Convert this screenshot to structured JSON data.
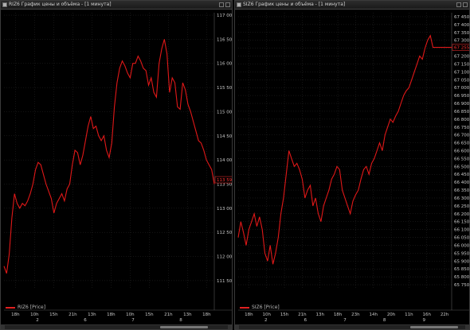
{
  "panels": [
    {
      "title": "RIZ6 График цены и объёма - [1 минута]",
      "legend": "RIZ6 [Price]",
      "last_price_label": "113 590",
      "colors": {
        "line": "#e01818",
        "grid": "#2a2a2a",
        "text": "#c8c8c8",
        "last": "#ff3030"
      },
      "chart_data": {
        "type": "line",
        "series": [
          {
            "name": "RIZ6 [Price]",
            "x": [
              0,
              3,
              6,
              9,
              12,
              15,
              18,
              21,
              24,
              27,
              30,
              33,
              36,
              39,
              42,
              45,
              48,
              51,
              54,
              57,
              60,
              63,
              66,
              69,
              72,
              75,
              78,
              81,
              84,
              87,
              90,
              93,
              96,
              99,
              102,
              105,
              108,
              111,
              114,
              117,
              120,
              123,
              126,
              129,
              132,
              135,
              138,
              141,
              144,
              147,
              150,
              153,
              156,
              159,
              162,
              165,
              168,
              171,
              174,
              177,
              180,
              183,
              186,
              189,
              192,
              195,
              198,
              201,
              204,
              207,
              210,
              213,
              216,
              219,
              222,
              225,
              228,
              231,
              234,
              237,
              240
            ],
            "values": [
              111800,
              111650,
              112050,
              112800,
              113300,
              113100,
              113000,
              113100,
              113050,
              113150,
              113300,
              113500,
              113800,
              113950,
              113900,
              113700,
              113500,
              113350,
              113200,
              112900,
              113100,
              113200,
              113300,
              113150,
              113400,
              113500,
              113900,
              114200,
              114150,
              113900,
              114100,
              114400,
              114700,
              114900,
              114650,
              114700,
              114500,
              114400,
              114500,
              114200,
              114050,
              114350,
              115100,
              115600,
              115900,
              116050,
              115950,
              115800,
              115700,
              116000,
              116000,
              116150,
              116050,
              115900,
              115850,
              115550,
              115700,
              115400,
              115300,
              116000,
              116300,
              116500,
              116200,
              115400,
              115700,
              115600,
              115100,
              115050,
              115600,
              115450,
              115150,
              115000,
              114800,
              114600,
              114400,
              114350,
              114200,
              114000,
              113900,
              113800,
              113500
            ]
          }
        ],
        "x_tick_labels": [
          "18h",
          "10h",
          "15h",
          "21h",
          "13h",
          "18h",
          "10h",
          "15h",
          "21h",
          "13h",
          "18h"
        ],
        "x_day_labels": [
          "2",
          "6",
          "7",
          "8"
        ],
        "y_tick_labels": [
          "117 000",
          "116 500",
          "116 000",
          "115 500",
          "115 000",
          "114 500",
          "114 000",
          "113 500",
          "113 000",
          "112 500",
          "112 000",
          "111 500"
        ],
        "ylim": [
          111350,
          117050
        ],
        "grid": true,
        "legend_position": "bottom-left"
      }
    },
    {
      "title": "SIZ6 График цены и объёма - [1 минута]",
      "legend": "SIZ6 [Price]",
      "last_price_label": "67 255",
      "colors": {
        "line": "#e01818",
        "grid": "#2a2a2a",
        "text": "#c8c8c8",
        "last": "#ff3030"
      },
      "chart_data": {
        "type": "line",
        "series": [
          {
            "name": "SIZ6 [Price]",
            "x": [
              0,
              3,
              6,
              9,
              12,
              15,
              18,
              21,
              24,
              27,
              30,
              33,
              36,
              39,
              42,
              45,
              48,
              51,
              54,
              57,
              60,
              63,
              66,
              69,
              72,
              75,
              78,
              81,
              84,
              87,
              90,
              93,
              96,
              99,
              102,
              105,
              108,
              111,
              114,
              117,
              120,
              123,
              126,
              129,
              132,
              135,
              138,
              141,
              144,
              147,
              150,
              153,
              156,
              159,
              162,
              165,
              168,
              171,
              174,
              177,
              180,
              183,
              186,
              189,
              192,
              195,
              198,
              201,
              204,
              207,
              210,
              213,
              216,
              219,
              222,
              225,
              228,
              231,
              234,
              237,
              240
            ],
            "values": [
              66050,
              66150,
              66080,
              66000,
              66100,
              66150,
              66200,
              66120,
              66180,
              66100,
              65950,
              65900,
              66000,
              65880,
              65950,
              66050,
              66200,
              66300,
              66450,
              66600,
              66550,
              66500,
              66520,
              66480,
              66420,
              66300,
              66350,
              66380,
              66250,
              66300,
              66200,
              66150,
              66250,
              66300,
              66350,
              66420,
              66450,
              66500,
              66480,
              66350,
              66300,
              66250,
              66200,
              66280,
              66320,
              66350,
              66420,
              66480,
              66500,
              66450,
              66520,
              66550,
              66600,
              66650,
              66600,
              66700,
              66750,
              66800,
              66780,
              66820,
              66850,
              66900,
              66950,
              66980,
              67000,
              67050,
              67100,
              67150,
              67200,
              67180,
              67250,
              67300,
              67330,
              67255,
              67255,
              67255,
              67255,
              67255,
              67255,
              67255,
              67255
            ]
          }
        ],
        "x_tick_labels": [
          "18h",
          "10h",
          "15h",
          "21h",
          "13h",
          "18h",
          "23h",
          "14h",
          "20h",
          "11h",
          "16h",
          "22h"
        ],
        "x_day_labels": [
          "2",
          "6",
          "7",
          "8",
          "9"
        ],
        "y_tick_labels": [
          "67 450",
          "67 400",
          "67 350",
          "67 300",
          "67 250",
          "67 200",
          "67 150",
          "67 100",
          "67 050",
          "67 000",
          "66 950",
          "66 900",
          "66 850",
          "66 800",
          "66 750",
          "66 700",
          "66 650",
          "66 600",
          "66 550",
          "66 500",
          "66 450",
          "66 400",
          "66 350",
          "66 300",
          "66 250",
          "66 200",
          "66 150",
          "66 100",
          "66 050",
          "66 000",
          "65 950",
          "65 900",
          "65 850",
          "65 800",
          "65 750"
        ],
        "ylim": [
          65730,
          67475
        ],
        "grid": true,
        "legend_position": "bottom-left"
      }
    }
  ]
}
